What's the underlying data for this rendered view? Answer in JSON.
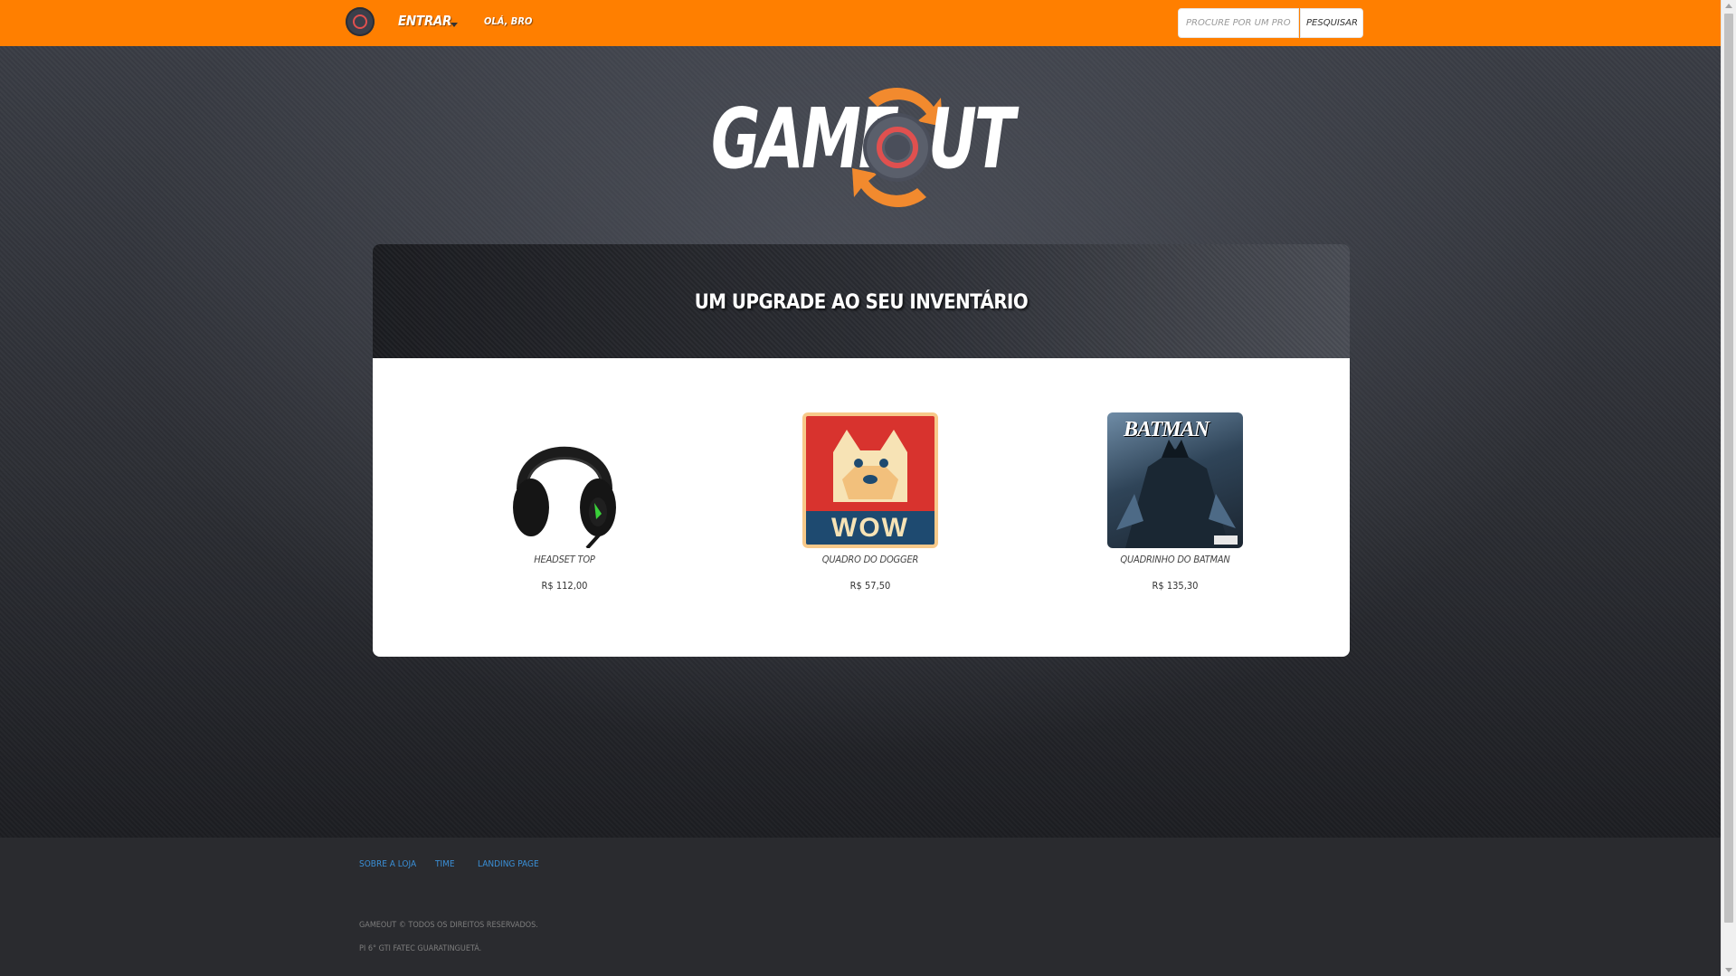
{
  "nav": {
    "login_label": "ENTRAR",
    "greeting": "OLÁ, BRO",
    "search_placeholder": "PROCURE POR UM PRODUTO",
    "search_button": "PESQUISAR"
  },
  "logo": {
    "left": "GAME",
    "right": "UT"
  },
  "panel": {
    "title": "UM UPGRADE AO SEU INVENTÁRIO"
  },
  "products": [
    {
      "name": "HEADSET TOP",
      "price": "R$ 112,00"
    },
    {
      "name": "QUADRO DO DOGGER",
      "price": "R$ 57,50",
      "image_text": "WOW"
    },
    {
      "name": "QUADRINHO DO BATMAN",
      "price": "R$ 135,30",
      "image_text": "BATMAN"
    }
  ],
  "footer": {
    "links": [
      "SOBRE A LOJA",
      "TIME",
      "LANDING PAGE"
    ],
    "copyright": "GAMEOUT © TODOS OS DIREITOS RESERVADOS.",
    "credit": "PI 6° GTI FATEC GUARATINGUETÁ."
  },
  "colors": {
    "nav": "#ff7f00",
    "footer_link": "#3a8fd6",
    "logo_accent": "#f28a2e",
    "logo_ring": "#e0504f"
  }
}
